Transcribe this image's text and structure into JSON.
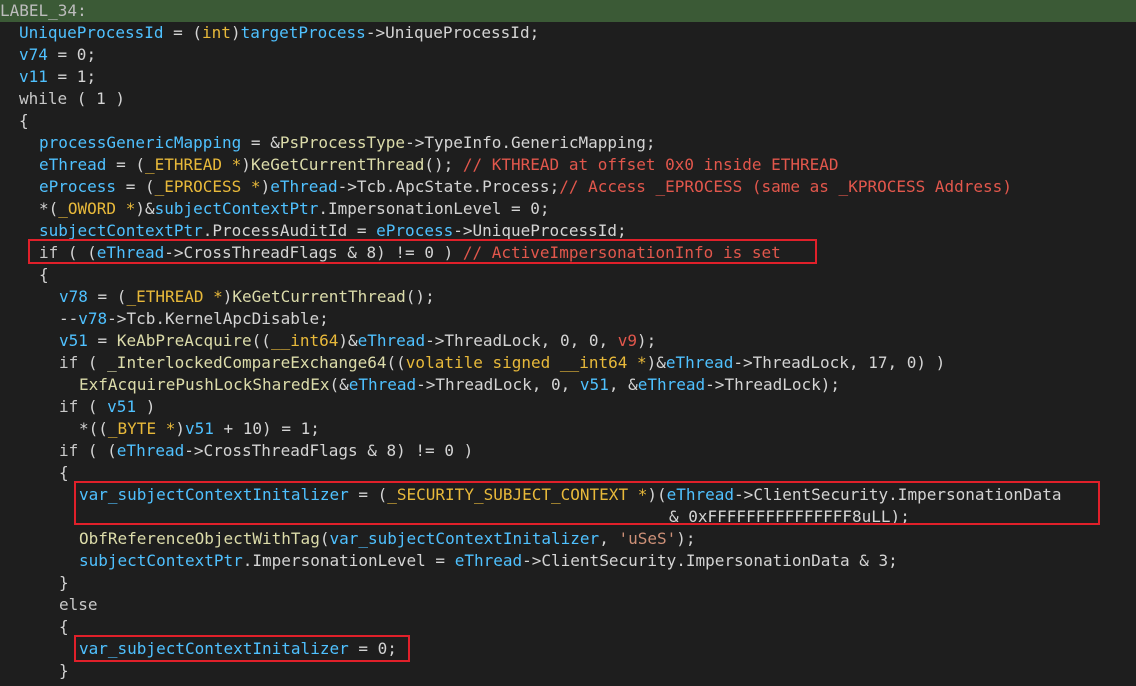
{
  "editor": {
    "highlight_color": "#3b5a36",
    "box_color": "#e0202a",
    "lines": [
      {
        "indent": 0,
        "highlight": true,
        "segments": [
          {
            "text": "LABEL_34:",
            "type": "lbl"
          }
        ]
      },
      {
        "indent": 1,
        "segments": [
          {
            "text": "UniqueProcessId",
            "type": "var"
          },
          {
            "text": " = (",
            "type": "pl"
          },
          {
            "text": "int",
            "type": "ty"
          },
          {
            "text": ")",
            "type": "pl"
          },
          {
            "text": "targetProcess",
            "type": "var"
          },
          {
            "text": "->UniqueProcessId;",
            "type": "pl"
          }
        ]
      },
      {
        "indent": 1,
        "segments": [
          {
            "text": "v74",
            "type": "var"
          },
          {
            "text": " = 0;",
            "type": "pl"
          }
        ]
      },
      {
        "indent": 1,
        "segments": [
          {
            "text": "v11",
            "type": "var"
          },
          {
            "text": " = 1;",
            "type": "pl"
          }
        ]
      },
      {
        "indent": 1,
        "segments": [
          {
            "text": "while",
            "type": "kw"
          },
          {
            "text": " ( 1 )",
            "type": "pl"
          }
        ]
      },
      {
        "indent": 1,
        "segments": [
          {
            "text": "{",
            "type": "pl"
          }
        ]
      },
      {
        "indent": 2,
        "segments": [
          {
            "text": "processGenericMapping",
            "type": "var"
          },
          {
            "text": " = &",
            "type": "pl"
          },
          {
            "text": "PsProcessType",
            "type": "fn"
          },
          {
            "text": "->TypeInfo.GenericMapping;",
            "type": "pl"
          }
        ]
      },
      {
        "indent": 2,
        "segments": [
          {
            "text": "eThread",
            "type": "var"
          },
          {
            "text": " = (",
            "type": "pl"
          },
          {
            "text": "_ETHREAD *",
            "type": "ty"
          },
          {
            "text": ")",
            "type": "pl"
          },
          {
            "text": "KeGetCurrentThread",
            "type": "fn"
          },
          {
            "text": "(); ",
            "type": "pl"
          },
          {
            "text": "// KTHREAD at offset 0x0 inside ETHREAD",
            "type": "cm"
          }
        ]
      },
      {
        "indent": 2,
        "segments": [
          {
            "text": "eProcess",
            "type": "var"
          },
          {
            "text": " = (",
            "type": "pl"
          },
          {
            "text": "_EPROCESS *",
            "type": "ty"
          },
          {
            "text": ")",
            "type": "pl"
          },
          {
            "text": "eThread",
            "type": "var"
          },
          {
            "text": "->Tcb.ApcState.Process;",
            "type": "pl"
          },
          {
            "text": "// Access _EPROCESS (same as _KPROCESS Address)",
            "type": "cm"
          }
        ]
      },
      {
        "indent": 2,
        "segments": [
          {
            "text": "*(",
            "type": "pl"
          },
          {
            "text": "_OWORD *",
            "type": "ty"
          },
          {
            "text": ")&",
            "type": "pl"
          },
          {
            "text": "subjectContextPtr",
            "type": "var"
          },
          {
            "text": ".ImpersonationLevel = 0;",
            "type": "pl"
          }
        ]
      },
      {
        "indent": 2,
        "segments": [
          {
            "text": "subjectContextPtr",
            "type": "var"
          },
          {
            "text": ".ProcessAuditId = ",
            "type": "pl"
          },
          {
            "text": "eProcess",
            "type": "var"
          },
          {
            "text": "->UniqueProcessId;",
            "type": "pl"
          }
        ]
      },
      {
        "indent": 2,
        "segments": [
          {
            "text": "if",
            "type": "kw"
          },
          {
            "text": " ( (",
            "type": "pl"
          },
          {
            "text": "eThread",
            "type": "var"
          },
          {
            "text": "->CrossThreadFlags & 8) != 0 ) ",
            "type": "pl"
          },
          {
            "text": "// ActiveImpersonationInfo is set",
            "type": "cm"
          }
        ]
      },
      {
        "indent": 2,
        "segments": [
          {
            "text": "{",
            "type": "pl"
          }
        ]
      },
      {
        "indent": 3,
        "segments": [
          {
            "text": "v78",
            "type": "var"
          },
          {
            "text": " = (",
            "type": "pl"
          },
          {
            "text": "_ETHREAD *",
            "type": "ty"
          },
          {
            "text": ")",
            "type": "pl"
          },
          {
            "text": "KeGetCurrentThread",
            "type": "fn"
          },
          {
            "text": "();",
            "type": "pl"
          }
        ]
      },
      {
        "indent": 3,
        "segments": [
          {
            "text": "--",
            "type": "pl"
          },
          {
            "text": "v78",
            "type": "var"
          },
          {
            "text": "->Tcb.KernelApcDisable;",
            "type": "pl"
          }
        ]
      },
      {
        "indent": 3,
        "segments": [
          {
            "text": "v51",
            "type": "var"
          },
          {
            "text": " = ",
            "type": "pl"
          },
          {
            "text": "KeAbPreAcquire",
            "type": "fn"
          },
          {
            "text": "((",
            "type": "pl"
          },
          {
            "text": "__int64",
            "type": "ty"
          },
          {
            "text": ")&",
            "type": "pl"
          },
          {
            "text": "eThread",
            "type": "var"
          },
          {
            "text": "->ThreadLock, 0, 0, ",
            "type": "pl"
          },
          {
            "text": "v9",
            "type": "cm"
          },
          {
            "text": ");",
            "type": "pl"
          }
        ]
      },
      {
        "indent": 3,
        "segments": [
          {
            "text": "if",
            "type": "kw"
          },
          {
            "text": " ( ",
            "type": "pl"
          },
          {
            "text": "_InterlockedCompareExchange64",
            "type": "fn"
          },
          {
            "text": "((",
            "type": "pl"
          },
          {
            "text": "volatile signed __int64 *",
            "type": "ty"
          },
          {
            "text": ")&",
            "type": "pl"
          },
          {
            "text": "eThread",
            "type": "var"
          },
          {
            "text": "->ThreadLock, 17, 0) )",
            "type": "pl"
          }
        ]
      },
      {
        "indent": 4,
        "segments": [
          {
            "text": "ExfAcquirePushLockSharedEx",
            "type": "fn"
          },
          {
            "text": "(&",
            "type": "pl"
          },
          {
            "text": "eThread",
            "type": "var"
          },
          {
            "text": "->ThreadLock, 0, ",
            "type": "pl"
          },
          {
            "text": "v51",
            "type": "var"
          },
          {
            "text": ", &",
            "type": "pl"
          },
          {
            "text": "eThread",
            "type": "var"
          },
          {
            "text": "->ThreadLock);",
            "type": "pl"
          }
        ]
      },
      {
        "indent": 3,
        "segments": [
          {
            "text": "if",
            "type": "kw"
          },
          {
            "text": " ( ",
            "type": "pl"
          },
          {
            "text": "v51",
            "type": "var"
          },
          {
            "text": " )",
            "type": "pl"
          }
        ]
      },
      {
        "indent": 4,
        "segments": [
          {
            "text": "*((",
            "type": "pl"
          },
          {
            "text": "_BYTE *",
            "type": "ty"
          },
          {
            "text": ")",
            "type": "pl"
          },
          {
            "text": "v51",
            "type": "var"
          },
          {
            "text": " + 10) = 1;",
            "type": "pl"
          }
        ]
      },
      {
        "indent": 3,
        "segments": [
          {
            "text": "if",
            "type": "kw"
          },
          {
            "text": " ( (",
            "type": "pl"
          },
          {
            "text": "eThread",
            "type": "var"
          },
          {
            "text": "->CrossThreadFlags & 8) != 0 )",
            "type": "pl"
          }
        ]
      },
      {
        "indent": 3,
        "segments": [
          {
            "text": "{",
            "type": "pl"
          }
        ]
      },
      {
        "indent": 4,
        "segments": [
          {
            "text": "var_subjectContextInitalizer",
            "type": "var"
          },
          {
            "text": " = (",
            "type": "pl"
          },
          {
            "text": "_SECURITY_SUBJECT_CONTEXT *",
            "type": "ty"
          },
          {
            "text": ")(",
            "type": "pl"
          },
          {
            "text": "eThread",
            "type": "var"
          },
          {
            "text": "->ClientSecurity.ImpersonationData",
            "type": "pl"
          }
        ]
      },
      {
        "indent": 4,
        "pad": 59,
        "segments": [
          {
            "text": "& 0xFFFFFFFFFFFFFFF8uLL);",
            "type": "pl"
          }
        ]
      },
      {
        "indent": 4,
        "segments": [
          {
            "text": "ObfReferenceObjectWithTag",
            "type": "fn"
          },
          {
            "text": "(",
            "type": "pl"
          },
          {
            "text": "var_subjectContextInitalizer",
            "type": "var"
          },
          {
            "text": ", ",
            "type": "pl"
          },
          {
            "text": "'uSeS'",
            "type": "str"
          },
          {
            "text": ");",
            "type": "pl"
          }
        ]
      },
      {
        "indent": 4,
        "segments": [
          {
            "text": "subjectContextPtr",
            "type": "var"
          },
          {
            "text": ".ImpersonationLevel = ",
            "type": "pl"
          },
          {
            "text": "eThread",
            "type": "var"
          },
          {
            "text": "->ClientSecurity.ImpersonationData & 3;",
            "type": "pl"
          }
        ]
      },
      {
        "indent": 3,
        "segments": [
          {
            "text": "}",
            "type": "pl"
          }
        ]
      },
      {
        "indent": 3,
        "segments": [
          {
            "text": "else",
            "type": "kw"
          }
        ]
      },
      {
        "indent": 3,
        "segments": [
          {
            "text": "{",
            "type": "pl"
          }
        ]
      },
      {
        "indent": 4,
        "segments": [
          {
            "text": "var_subjectContextInitalizer",
            "type": "var"
          },
          {
            "text": " = 0;",
            "type": "pl"
          }
        ]
      },
      {
        "indent": 3,
        "segments": [
          {
            "text": "}",
            "type": "pl"
          }
        ]
      }
    ]
  }
}
